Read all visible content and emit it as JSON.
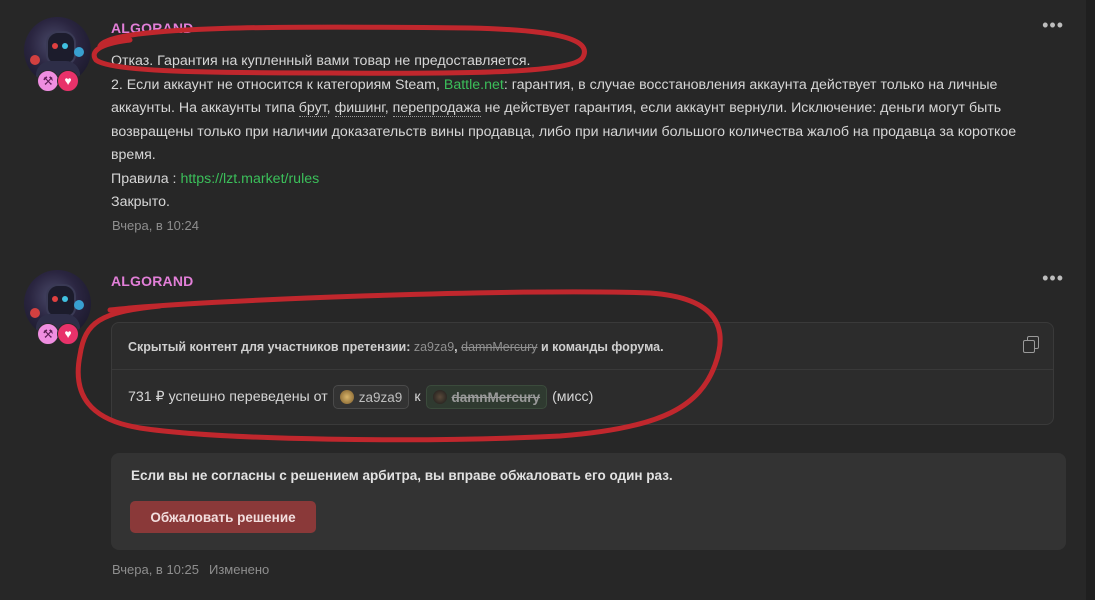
{
  "posts": [
    {
      "username": "ALGORAND",
      "more": "•••",
      "line1": "Отказ. Гарантия на купленный вами товар не предоставляется.",
      "para_prefix": "2. Если аккаунт не относится к категориям Steam, ",
      "para_link": "Battle.net",
      "para_mid1": ": гарантия, в случае восстановления аккаунта действует только на личные аккаунты. На аккаунты типа ",
      "para_brut": "брут",
      "para_comma": ", ",
      "para_phishing": "фишинг",
      "para_mid2": ", ",
      "para_resale": "перепродажа",
      "para_end": " не действует гарантия, если аккаунт вернули. Исключение: деньги могут быть возвращены только при наличии доказательств вины продавца, либо при наличии большого количества жалоб на продавца за короткое время.",
      "rules_label": "Правила : ",
      "rules_link": "https://lzt.market/rules",
      "closed": "Закрыто.",
      "time": "Вчера, в 10:24"
    },
    {
      "username": "ALGORAND",
      "more": "•••",
      "hidden_prefix": "Скрытый контент для участников претензии: ",
      "hidden_user1": "za9za9",
      "hidden_comma": ", ",
      "hidden_user2": "damnMercury",
      "hidden_suffix": " и команды форума.",
      "transfer_text": "731 ₽ успешно переведены от",
      "transfer_from": "za9za9",
      "transfer_to_word": "к",
      "transfer_to": "damnMercury",
      "transfer_note": "(мисс)",
      "appeal_text": "Если вы не согласны с решением арбитра, вы вправе обжаловать его один раз.",
      "appeal_button": "Обжаловать решение",
      "time": "Вчера, в 10:25",
      "edited": "Изменено"
    }
  ],
  "colors": {
    "background": "#272727",
    "username": "#e27fd8",
    "link": "#3bbf5a",
    "appeal_button": "#8a3939",
    "annotation": "#c0272d"
  },
  "icons": [
    "hammer-icon",
    "heart-icon",
    "copy-icon",
    "more-icon"
  ]
}
